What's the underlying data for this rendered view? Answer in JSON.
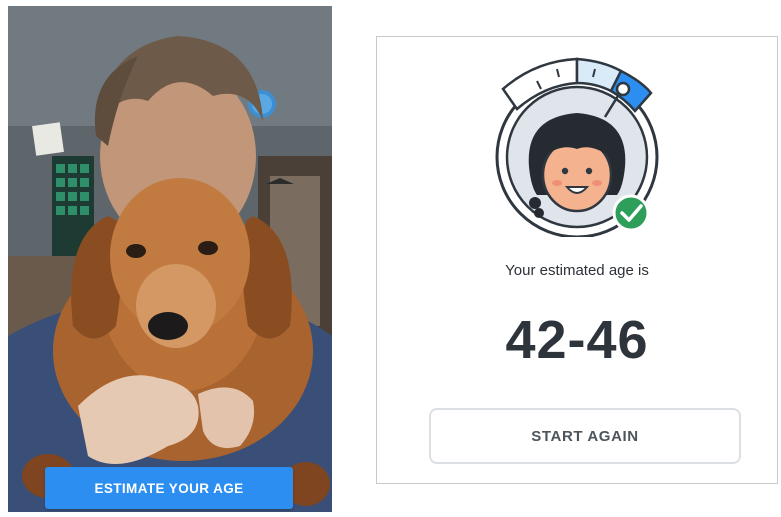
{
  "photo_panel": {
    "estimate_button_label": "ESTIMATE YOUR AGE"
  },
  "result": {
    "caption": "Your estimated age is",
    "age_range": "42-46",
    "start_again_label": "START AGAIN"
  },
  "colors": {
    "primary_blue": "#2b8ef0",
    "check_green": "#2e9e5b",
    "age_text": "#2e343b"
  }
}
